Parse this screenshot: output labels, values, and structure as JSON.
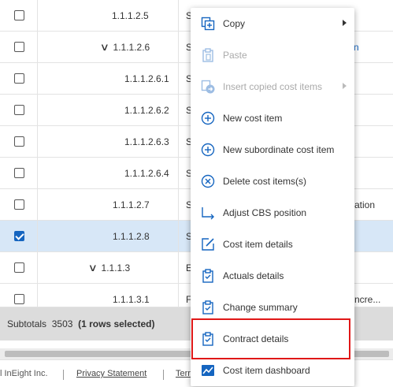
{
  "rows": [
    {
      "code": "1.1.1.2.5",
      "name_fragment": "S",
      "trail": "",
      "checked": false,
      "expander": false
    },
    {
      "code": "1.1.1.2.6",
      "name_fragment": "S",
      "trail": "n",
      "checked": false,
      "expander": true
    },
    {
      "code": "1.1.1.2.6.1",
      "name_fragment": "S",
      "trail": "",
      "checked": false,
      "expander": false
    },
    {
      "code": "1.1.1.2.6.2",
      "name_fragment": "S",
      "trail": "",
      "checked": false,
      "expander": false
    },
    {
      "code": "1.1.1.2.6.3",
      "name_fragment": "S",
      "trail": "",
      "checked": false,
      "expander": false
    },
    {
      "code": "1.1.1.2.6.4",
      "name_fragment": "S",
      "trail": "",
      "checked": false,
      "expander": false
    },
    {
      "code": "1.1.1.2.7",
      "name_fragment": "S",
      "trail": "ation",
      "checked": false,
      "expander": false
    },
    {
      "code": "1.1.1.2.8",
      "name_fragment": "S",
      "trail": "",
      "checked": true,
      "expander": false
    },
    {
      "code": "1.1.1.3",
      "name_fragment": "E",
      "trail": "",
      "checked": false,
      "expander": true
    },
    {
      "code": "1.1.1.3.1",
      "name_fragment": "F",
      "trail": "ncre...",
      "checked": false,
      "expander": false
    }
  ],
  "subtotals": {
    "label": "Subtotals",
    "value": "3503",
    "selection": "(1 rows selected)"
  },
  "footer": {
    "copyright": "l InEight Inc.",
    "privacy": "Privacy Statement",
    "terms": "Terr"
  },
  "context_menu": {
    "items": [
      {
        "label": "Copy",
        "icon": "copy-icon",
        "disabled": false,
        "submenu": true
      },
      {
        "label": "Paste",
        "icon": "paste-icon",
        "disabled": true,
        "submenu": false
      },
      {
        "label": "Insert copied cost items",
        "icon": "insert-copied-icon",
        "disabled": true,
        "submenu": true
      },
      {
        "label": "New cost item",
        "icon": "plus-circle-icon",
        "disabled": false,
        "submenu": false
      },
      {
        "label": "New subordinate cost item",
        "icon": "plus-circle-icon",
        "disabled": false,
        "submenu": false
      },
      {
        "label": "Delete cost items(s)",
        "icon": "x-circle-icon",
        "disabled": false,
        "submenu": false
      },
      {
        "label": "Adjust CBS position",
        "icon": "turn-right-arrow-icon",
        "disabled": false,
        "submenu": false
      },
      {
        "label": "Cost item details",
        "icon": "edit-icon",
        "disabled": false,
        "submenu": false
      },
      {
        "label": "Actuals details",
        "icon": "clipboard-check-icon",
        "disabled": false,
        "submenu": false
      },
      {
        "label": "Change summary",
        "icon": "clipboard-check-icon",
        "disabled": false,
        "submenu": false
      },
      {
        "label": "Contract details",
        "icon": "clipboard-check-icon",
        "disabled": false,
        "submenu": false
      },
      {
        "label": "Cost item dashboard",
        "icon": "dashboard-chart-icon",
        "disabled": false,
        "submenu": false
      }
    ],
    "highlighted_item": "Contract details"
  },
  "colors": {
    "accent": "#1565c0",
    "selected_row": "#d7e7f7",
    "highlight_border": "#e01818",
    "subtotals_bg": "#dcdcdc"
  }
}
